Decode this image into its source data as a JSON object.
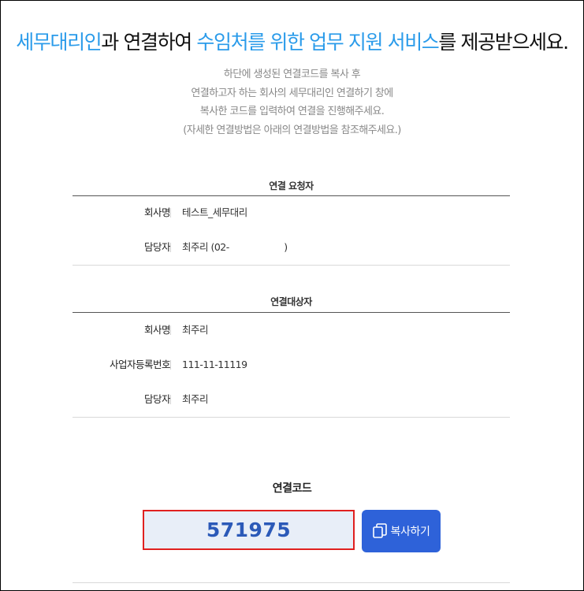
{
  "headline": {
    "part1": "세무대리인",
    "part2": "과 연결하여 ",
    "part3": "수임처를 위한 업무 지원 서비스",
    "part4": "를 제공받으세요."
  },
  "description": [
    "하단에 생성된 연결코드를 복사 후",
    "연결하고자 하는 회사의 세무대리인 연결하기 창에",
    "복사한 코드를 입력하여 연결을 진행해주세요.",
    "(자세한 연결방법은 아래의 연결방법을 참조해주세요.)"
  ],
  "requester": {
    "title": "연결 요청자",
    "rows": [
      {
        "label": "회사명",
        "value": "테스트_세무대리"
      },
      {
        "label": "담당자",
        "value": "최주리 (02-                    )"
      }
    ]
  },
  "target": {
    "title": "연결대상자",
    "rows": [
      {
        "label": "회사명",
        "value": "최주리"
      },
      {
        "label": "사업자등록번호",
        "value": "111-11-11119"
      },
      {
        "label": "담당자",
        "value": "최주리"
      }
    ]
  },
  "connection_code": {
    "label": "연결코드",
    "value": "571975",
    "copy_button_label": "복사하기",
    "copy_icon": "copy-icon"
  },
  "colors": {
    "highlight": "#2a9bea",
    "code_text": "#2b59b8",
    "code_bg": "#e8eef8",
    "code_border": "#e02020",
    "button_bg": "#2e62d9"
  }
}
